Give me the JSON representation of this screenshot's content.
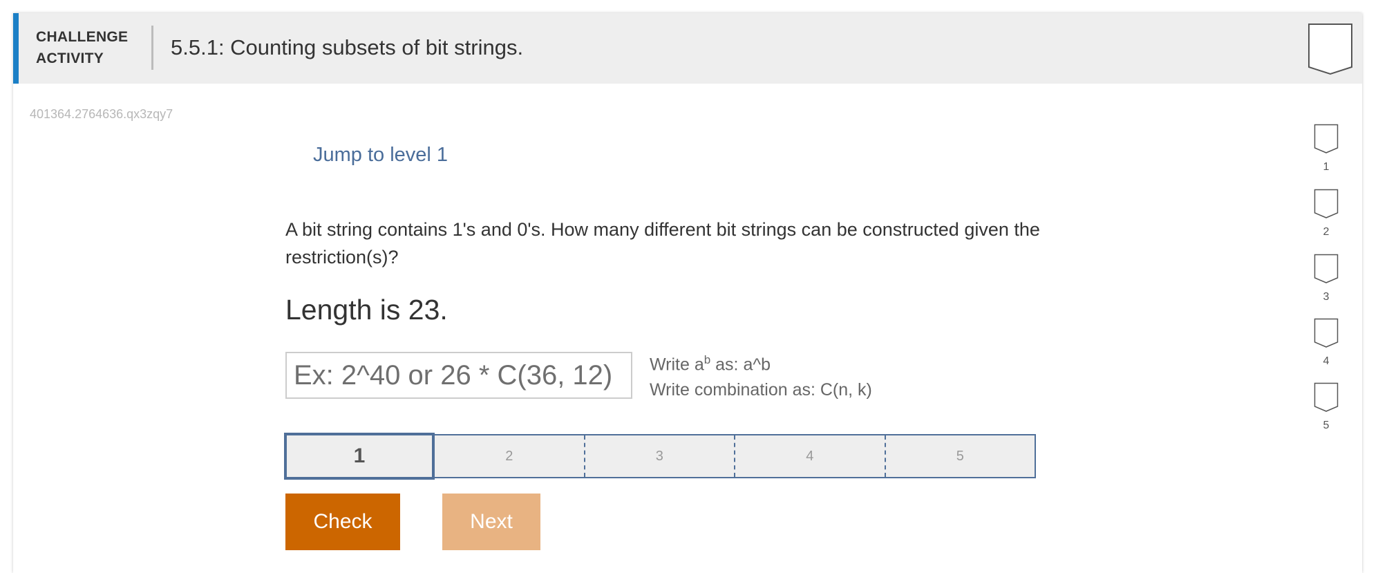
{
  "header": {
    "kind_line1": "CHALLENGE",
    "kind_line2": "ACTIVITY",
    "title": "5.5.1: Counting subsets of bit strings."
  },
  "activity_id": "401364.2764636.qx3zqy7",
  "jump_link": "Jump to level 1",
  "question": "A bit string contains 1's and 0's. How many different bit strings can be constructed given the restriction(s)?",
  "restriction": "Length is 23.",
  "answer": {
    "value": "",
    "placeholder": "Ex: 2^40 or 26 * C(36, 12)"
  },
  "hint": {
    "line1_prefix": "Write a",
    "line1_sup": "b",
    "line1_suffix": " as: a^b",
    "line2": "Write combination as: C(n, k)"
  },
  "levels": [
    "1",
    "2",
    "3",
    "4",
    "5"
  ],
  "current_level": "1",
  "buttons": {
    "check": "Check",
    "next": "Next"
  },
  "side_levels": [
    "1",
    "2",
    "3",
    "4",
    "5"
  ],
  "colors": {
    "accent": "#1b7fc6",
    "check": "#cc6600",
    "next_disabled": "#e8b382",
    "level_border": "#4f6f99",
    "link": "#4a6d9a"
  },
  "icons": {
    "badge": "shield-outline-icon",
    "side_level": "level-shield-icon"
  }
}
